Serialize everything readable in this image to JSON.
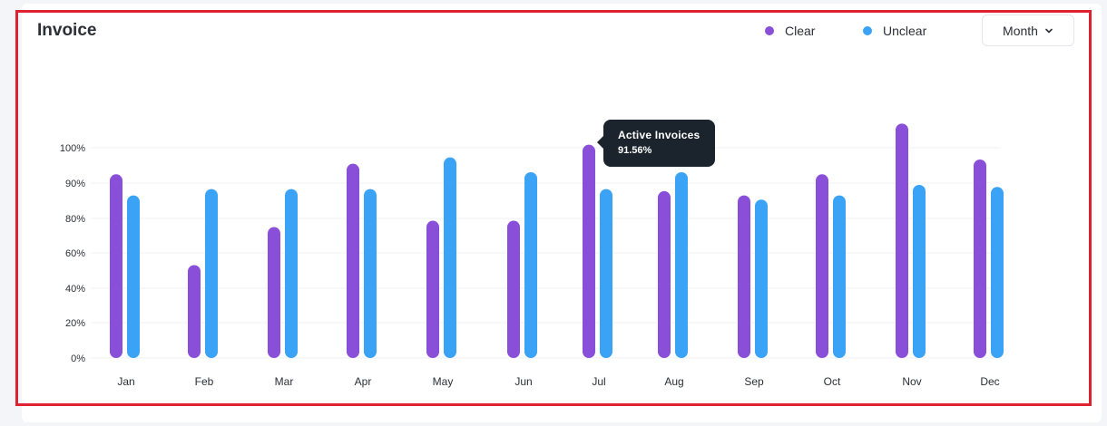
{
  "card": {
    "title": "Invoice",
    "period_button": "Month",
    "period_icon": "chevron-down-icon"
  },
  "legend": [
    {
      "label": "Clear",
      "color": "#8a4fd9"
    },
    {
      "label": "Unclear",
      "color": "#3aa3f5"
    }
  ],
  "tooltip": {
    "title": "Active Invoices",
    "value": "91.56%"
  },
  "chart_data": {
    "type": "bar",
    "categories": [
      "Jan",
      "Feb",
      "Mar",
      "Apr",
      "May",
      "Jun",
      "Jul",
      "Aug",
      "Sep",
      "Oct",
      "Nov",
      "Dec"
    ],
    "series": [
      {
        "name": "Clear",
        "color": "#8a4fd9",
        "values": [
          87,
          44,
          62,
          92,
          65,
          65,
          101,
          79,
          77,
          87,
          111,
          94
        ]
      },
      {
        "name": "Unclear",
        "color": "#3aa3f5",
        "values": [
          77,
          80,
          80,
          80,
          95,
          88,
          80,
          88,
          75,
          77,
          82,
          81
        ]
      }
    ],
    "yticks": [
      "0%",
      "20%",
      "40%",
      "60%",
      "80%",
      "90%",
      "100%"
    ],
    "ytick_values": [
      0,
      20,
      40,
      60,
      80,
      90,
      100
    ],
    "ylim": [
      0,
      120
    ],
    "grid": true,
    "legend_position": "top-right"
  }
}
